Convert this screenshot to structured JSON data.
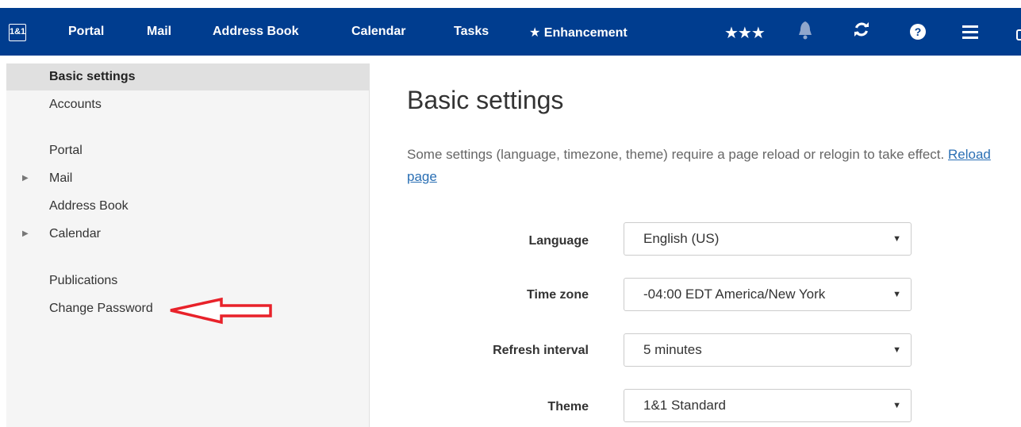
{
  "nav": {
    "logo": "1&1",
    "links": [
      "Portal",
      "Mail",
      "Address Book",
      "Calendar",
      "Tasks"
    ],
    "enhancement": "Enhancement",
    "stars": "★★★",
    "star_glyph": "★"
  },
  "sidebar": {
    "items": [
      "Basic settings",
      "Accounts",
      "Portal",
      "Mail",
      "Address Book",
      "Calendar",
      "Publications",
      "Change Password"
    ]
  },
  "main": {
    "title": "Basic settings",
    "note": "Some settings (language, timezone, theme) require a page reload or relogin to take effect.",
    "reload_link": "Reload page",
    "fields": [
      {
        "label": "Language",
        "value": "English (US)"
      },
      {
        "label": "Time zone",
        "value": "-04:00 EDT America/New York"
      },
      {
        "label": "Refresh interval",
        "value": "5 minutes"
      },
      {
        "label": "Theme",
        "value": "1&1 Standard"
      }
    ]
  },
  "colors": {
    "navbar": "#003d8f",
    "annotation_arrow": "#e8222a",
    "link": "#2a6fb4"
  }
}
